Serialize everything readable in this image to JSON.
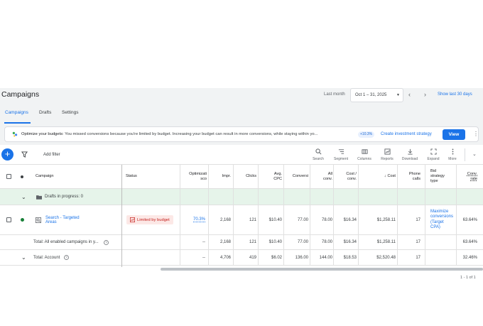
{
  "header": {
    "title": "Campaigns",
    "date_label": "Last month",
    "date_range": "Oct 1 – 31, 2025",
    "show_last": "Show last 30 days"
  },
  "tabs": [
    {
      "label": "Campaigns",
      "active": true
    },
    {
      "label": "Drafts",
      "active": false
    },
    {
      "label": "Settings",
      "active": false
    }
  ],
  "banner": {
    "title": "Optimize your budgets:",
    "message": "You missed conversions because you're limited by budget. Increasing your budget can result in more conversions, while staying within yo...",
    "chip": "+10.3%",
    "link": "Create investment strategy",
    "button": "View"
  },
  "toolbar": {
    "add_filter": "Add filter",
    "tools": [
      {
        "label": "Search",
        "icon": "search-icon"
      },
      {
        "label": "Segment",
        "icon": "segment-icon"
      },
      {
        "label": "Columns",
        "icon": "columns-icon"
      },
      {
        "label": "Reports",
        "icon": "reports-icon"
      },
      {
        "label": "Download",
        "icon": "download-icon"
      },
      {
        "label": "Expand",
        "icon": "expand-icon"
      },
      {
        "label": "More",
        "icon": "more-icon"
      }
    ]
  },
  "table": {
    "headers": {
      "campaign": "Campaign",
      "status": "Status",
      "optimization_1": "Optimizati",
      "optimization_2": "sco",
      "impr": "Impr.",
      "clicks": "Clicks",
      "avg_cpc_1": "Avg.",
      "avg_cpc_2": "CPC",
      "conversions": "Conversi",
      "all_conv_1": "All",
      "all_conv_2": "conv.",
      "cost_conv_1": "Cost /",
      "cost_conv_2": "conv.",
      "cost": "Cost",
      "phone_1": "Phone",
      "phone_2": "calls",
      "bid_1": "Bid",
      "bid_2": "strategy",
      "bid_3": "type",
      "conv_rate_1": "Conv.",
      "conv_rate_2": "rate"
    },
    "drafts_row": "Drafts in progress: 0",
    "campaign_row": {
      "name_1": "Search - Targeted",
      "name_2": "Areas",
      "status": "Limited by budget",
      "opt_score": "70.3%",
      "impr": "2,168",
      "clicks": "121",
      "avg_cpc": "$10.40",
      "conversions": "77.00",
      "all_conv": "78.00",
      "cost_conv": "$16.34",
      "cost": "$1,258.11",
      "phone": "17",
      "bid_1": "Maximize",
      "bid_2": "conversions",
      "bid_3": "(Target",
      "bid_4": "CPA)",
      "conv_rate": "63.64%"
    },
    "total_enabled": {
      "label": "Total: All enabled campaigns in y...",
      "opt_score": "--",
      "impr": "2,168",
      "clicks": "121",
      "avg_cpc": "$10.40",
      "conversions": "77.00",
      "all_conv": "78.00",
      "cost_conv": "$16.34",
      "cost": "$1,258.11",
      "phone": "17",
      "conv_rate": "63.64%"
    },
    "total_account": {
      "label": "Total: Account",
      "opt_score": "--",
      "impr": "4,706",
      "clicks": "419",
      "avg_cpc": "$6.02",
      "conversions": "136.00",
      "all_conv": "144.00",
      "cost_conv": "$18.53",
      "cost": "$2,520.48",
      "phone": "17",
      "conv_rate": "32.46%"
    },
    "pagination": "1 - 1 of 1"
  },
  "colors": {
    "accent": "#1a73e8",
    "enabled_dot": "#188038",
    "limited_bg": "#fce8e6",
    "limited_text": "#c5221f",
    "drafts_bg": "#e6f4ea"
  }
}
